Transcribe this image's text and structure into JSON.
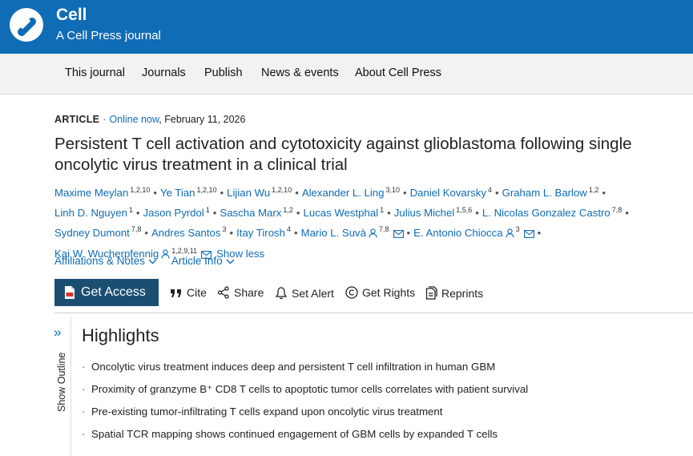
{
  "brand": {
    "name": "Cell",
    "tagline": "A Cell Press journal",
    "accent": "#0f6cb5",
    "logo_icon": "cell-press-logo"
  },
  "nav": [
    "This journal",
    "Journals",
    "Publish",
    "News & events",
    "About Cell Press"
  ],
  "meta": {
    "type": "ARTICLE",
    "online_now": "Online now",
    "date": ", February 11, 2026"
  },
  "title": "Persistent T cell activation and cytotoxicity against glioblastoma following single oncolytic virus treatment in a clinical trial",
  "authors": [
    {
      "name": "Maxime Meylan",
      "sup": "1,2,10"
    },
    {
      "name": "Ye Tian",
      "sup": "1,2,10"
    },
    {
      "name": "Lijian Wu",
      "sup": "1,2,10"
    },
    {
      "name": "Alexander L. Ling",
      "sup": "3,10"
    },
    {
      "name": "Daniel Kovarsky",
      "sup": "4"
    },
    {
      "name": "Graham L. Barlow",
      "sup": "1,2"
    },
    {
      "name": "Linh D. Nguyen",
      "sup": "1"
    },
    {
      "name": "Jason Pyrdol",
      "sup": "1"
    },
    {
      "name": "Sascha Marx",
      "sup": "1,2"
    },
    {
      "name": "Lucas Westphal",
      "sup": "1"
    },
    {
      "name": "Julius Michel",
      "sup": "1,5,6"
    },
    {
      "name": "L. Nicolas Gonzalez Castro",
      "sup": "7,8"
    },
    {
      "name": "Sydney Dumont",
      "sup": "7,8"
    },
    {
      "name": "Andres Santos",
      "sup": "3"
    },
    {
      "name": "Itay Tirosh",
      "sup": "4"
    },
    {
      "name": "Mario L. Suvà",
      "sup": "7,8"
    },
    {
      "name": "E. Antonio Chiocca",
      "sup": "3"
    },
    {
      "name": "Kai W. Wucherpfennig",
      "sup": "1,2,9,11"
    }
  ],
  "show_less": "Show less",
  "links": {
    "affiliations": "Affiliations & Notes",
    "article_info": "Article Info"
  },
  "toolbar": {
    "get_access": "Get Access",
    "cite": "Cite",
    "share": "Share",
    "set_alert": "Set Alert",
    "get_rights": "Get Rights",
    "reprints": "Reprints",
    "access_color": "#1b4f72"
  },
  "outline_label": "Show Outline",
  "highlights": {
    "title": "Highlights",
    "items": [
      "Oncolytic virus treatment induces deep and persistent T cell infiltration in human GBM",
      "Proximity of granzyme B⁺ CD8 T cells to apoptotic tumor cells correlates with patient survival",
      "Pre-existing tumor-infiltrating T cells expand upon oncolytic virus treatment",
      "Spatial TCR mapping shows continued engagement of GBM cells by expanded T cells"
    ]
  }
}
